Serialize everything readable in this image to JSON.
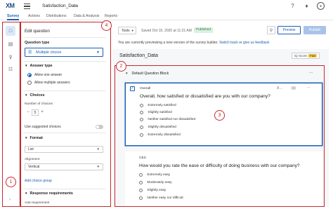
{
  "header": {
    "logo": "XM",
    "project_title": "Satisfaction_Data",
    "project_caret": "⌄",
    "icons": [
      "help-icon",
      "notifications-icon",
      "account-icon"
    ]
  },
  "nav": {
    "tabs": [
      {
        "label": "Survey",
        "active": true
      },
      {
        "label": "Actions",
        "active": false
      },
      {
        "label": "Distributions",
        "active": false
      },
      {
        "label": "Data & Analysis",
        "active": false
      },
      {
        "label": "Reports",
        "active": false
      }
    ]
  },
  "panel": {
    "title": "Edit question",
    "question_type_label": "Question type",
    "question_type_value": "Multiple choice",
    "answer_type_label": "Answer type",
    "answer_options": [
      {
        "label": "Allow one answer",
        "checked": true
      },
      {
        "label": "Allow multiple answers",
        "checked": false
      }
    ],
    "choices_label": "Choices",
    "num_choices_label": "Number of choices",
    "num_choices_minus": "−",
    "num_choices_value": "5",
    "num_choices_plus": "+",
    "suggested_choices_label": "Use suggested choices",
    "format_label": "Format",
    "format_value": "List",
    "alignment_label": "Alignment",
    "alignment_value": "Vertical",
    "add_choice_group": "Add choice group",
    "response_requirements_label": "Response requirements",
    "add_requirement_partial": "Add requirement"
  },
  "toolbar": {
    "tools_label": "Tools",
    "saved_text": "Saved Oct 15, 2020 at 11:21 AM",
    "status_badge": "Published",
    "preview_label": "Preview",
    "publish_label": "Publish"
  },
  "notice": {
    "prefix": "You are currently previewing a new version of the survey builder.",
    "switch_back": "Switch back",
    "or": "or",
    "give_feedback": "give us feedback"
  },
  "survey": {
    "title": "Satisfaction_Data",
    "iq_score_label": "iQ Score:",
    "iq_score_value": "Fair",
    "block_title": "Default Question Block",
    "block_more": "...",
    "questions": [
      {
        "id": "Overall",
        "text": "Overall, how satisfied or dissatisfied are you with our company?",
        "tools": [
          "X→",
          "{x}",
          "..."
        ],
        "choices": [
          "Extremely satisfied",
          "Slightly satisfied",
          "Neither satisfied nor dissatisfied",
          "Slightly dissatisfied",
          "Extremely dissatisfied"
        ]
      },
      {
        "id": "CES",
        "text": "How would you rate the ease or difficulty of doing business with our company?",
        "choices": [
          "Extremely easy",
          "Moderately easy",
          "Slightly easy",
          "Neither easy nor difficult"
        ]
      }
    ]
  },
  "callouts": [
    "1",
    "2",
    "3",
    "4"
  ],
  "colors": {
    "accent": "#1a5db5",
    "callout": "#c8282e",
    "published_bg": "#daf0e0",
    "fair_badge": "#f4c542"
  }
}
